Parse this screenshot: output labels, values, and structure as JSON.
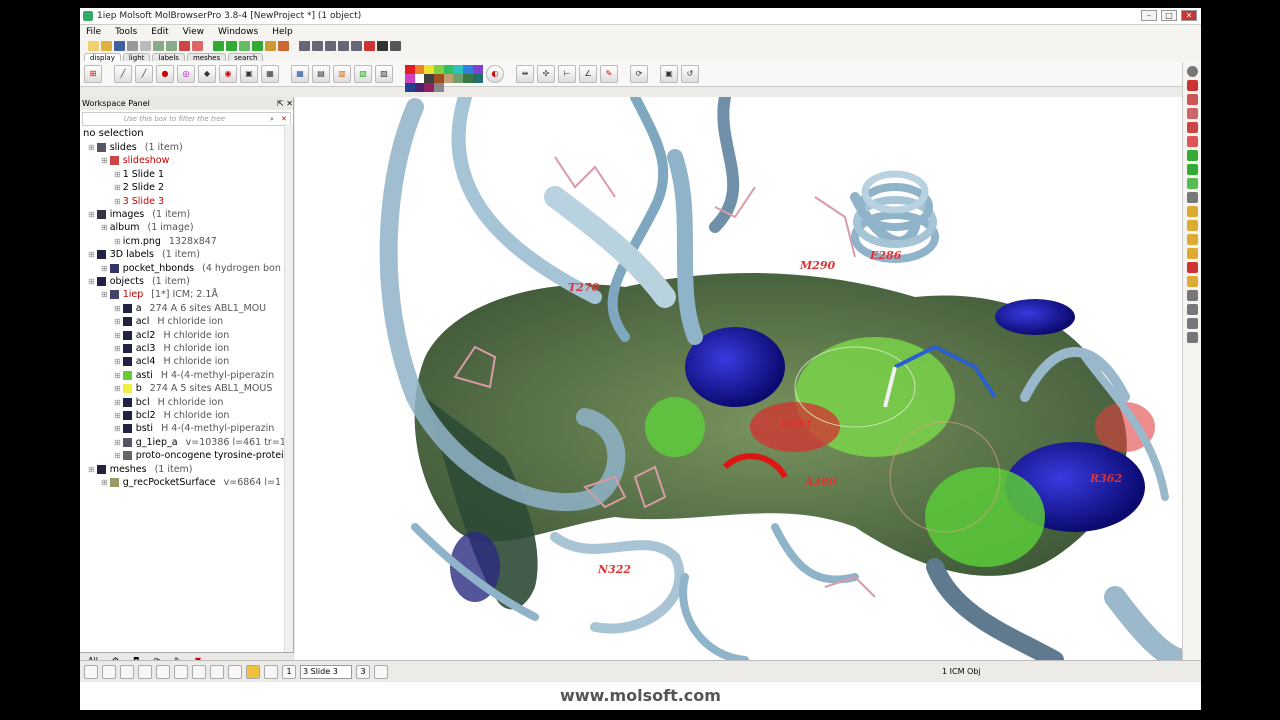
{
  "window": {
    "title": "1iep Molsoft MolBrowserPro 3.8-4  [NewProject *] (1 object)"
  },
  "menu": [
    "File",
    "Tools",
    "Edit",
    "View",
    "Windows",
    "Help"
  ],
  "tabs": [
    "display",
    "light",
    "labels",
    "meshes",
    "search"
  ],
  "palette_colors": [
    "#e02020",
    "#f08030",
    "#f0e030",
    "#80d040",
    "#30c060",
    "#30c0c0",
    "#3080e0",
    "#8040d0",
    "#d040c0",
    "#ffffff",
    "#404040",
    "#a05020",
    "#c0a070",
    "#70a070",
    "#3a7a40",
    "#207070",
    "#204090",
    "#502070",
    "#902060",
    "#888888"
  ],
  "workspace": {
    "title": "Workspace Panel",
    "filter_placeholder": "Use this box to filter the tree",
    "selection_text": "no selection"
  },
  "tree": [
    {
      "label": "slides",
      "count": "(1 item)",
      "indent": 0,
      "color": "#000",
      "icon": "#556"
    },
    {
      "label": "slideshow",
      "count": "",
      "indent": 1,
      "color": "#c00",
      "icon": "#c44"
    },
    {
      "label": "1 Slide 1",
      "count": "",
      "indent": 2,
      "color": "#000",
      "icon": ""
    },
    {
      "label": "2 Slide 2",
      "count": "",
      "indent": 2,
      "color": "#000",
      "icon": ""
    },
    {
      "label": "3 Slide 3",
      "count": "",
      "indent": 2,
      "color": "#c00",
      "icon": ""
    },
    {
      "label": "images",
      "count": "(1 item)",
      "indent": 0,
      "color": "#000",
      "icon": "#334"
    },
    {
      "label": "album",
      "count": "(1 image)",
      "indent": 1,
      "color": "#000",
      "icon": ""
    },
    {
      "label": "icm.png",
      "count": "1328x847",
      "indent": 2,
      "color": "#000",
      "icon": ""
    },
    {
      "label": "3D labels",
      "count": "(1 item)",
      "indent": 0,
      "color": "#000",
      "icon": "#224"
    },
    {
      "label": "pocket_hbonds",
      "count": "(4 hydrogen bon",
      "indent": 1,
      "color": "#000",
      "icon": "#336"
    },
    {
      "label": "objects",
      "count": "(1 item)",
      "indent": 0,
      "color": "#000",
      "icon": "#224"
    },
    {
      "label": "1iep",
      "count": "[1*] ICM; 2.1Å",
      "indent": 1,
      "color": "#c00",
      "icon": "#446"
    },
    {
      "label": "a",
      "count": "274 A  6 sites ABL1_MOU",
      "indent": 2,
      "color": "#000",
      "icon": "#224"
    },
    {
      "label": "acl",
      "count": "H   chloride ion",
      "indent": 2,
      "color": "#000",
      "icon": "#224"
    },
    {
      "label": "acl2",
      "count": "H   chloride ion",
      "indent": 2,
      "color": "#000",
      "icon": "#224"
    },
    {
      "label": "acl3",
      "count": "H   chloride ion",
      "indent": 2,
      "color": "#000",
      "icon": "#224"
    },
    {
      "label": "acl4",
      "count": "H   chloride ion",
      "indent": 2,
      "color": "#000",
      "icon": "#224"
    },
    {
      "label": "asti",
      "count": "H   4-(4-methyl-piperazin",
      "indent": 2,
      "color": "#000",
      "icon": "#6c3"
    },
    {
      "label": "b",
      "count": "274 A  5 sites ABL1_MOUS",
      "indent": 2,
      "color": "#000",
      "icon": "#ee4"
    },
    {
      "label": "bcl",
      "count": "H   chloride ion",
      "indent": 2,
      "color": "#000",
      "icon": "#224"
    },
    {
      "label": "bcl2",
      "count": "H   chloride ion",
      "indent": 2,
      "color": "#000",
      "icon": "#224"
    },
    {
      "label": "bsti",
      "count": "H   4-(4-methyl-piperazin",
      "indent": 2,
      "color": "#000",
      "icon": "#224"
    },
    {
      "label": "g_1iep_a",
      "count": "v=10386 l=461 tr=1",
      "indent": 2,
      "color": "#000",
      "icon": "#556"
    },
    {
      "label": "proto-oncogene tyrosine-proteir",
      "count": "",
      "indent": 2,
      "color": "#000",
      "icon": "#666"
    },
    {
      "label": "meshes",
      "count": "(1 item)",
      "indent": 0,
      "color": "#000",
      "icon": "#224"
    },
    {
      "label": "g_recPocketSurface",
      "count": "v=6864 l=1",
      "indent": 1,
      "color": "#000",
      "icon": "#996"
    }
  ],
  "bottom_tabs": [
    "All"
  ],
  "residue_labels": [
    {
      "text": "A380",
      "color": "#d33"
    },
    {
      "text": "D381",
      "color": "#d33"
    },
    {
      "text": "N322",
      "color": "#d33"
    },
    {
      "text": "T270",
      "color": "#d33"
    },
    {
      "text": "M290",
      "color": "#d33"
    },
    {
      "text": "E286",
      "color": "#d33"
    },
    {
      "text": "R362",
      "color": "#d33"
    }
  ],
  "status": {
    "slide_select": "3 Slide 3",
    "page_index": "1",
    "page_total": "3",
    "object_count": "1 ICM Obj"
  },
  "footer": {
    "text": "www.molsoft.com"
  }
}
